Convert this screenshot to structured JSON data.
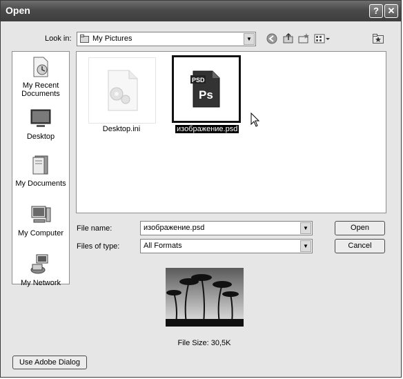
{
  "window": {
    "title": "Open",
    "help_label": "?",
    "close_label": "✕"
  },
  "lookin": {
    "label": "Look in:",
    "value": "My Pictures"
  },
  "places": [
    {
      "label": "My Recent Documents",
      "icon": "recent-documents-icon"
    },
    {
      "label": "Desktop",
      "icon": "desktop-icon"
    },
    {
      "label": "My Documents",
      "icon": "my-documents-icon"
    },
    {
      "label": "My Computer",
      "icon": "my-computer-icon"
    },
    {
      "label": "My Network",
      "icon": "my-network-icon"
    }
  ],
  "files": [
    {
      "name": "Desktop.ini",
      "icon": "ini-file-icon",
      "selected": false
    },
    {
      "name": "изображение.psd",
      "icon": "psd-file-icon",
      "selected": true,
      "badge": "PSD",
      "logo": "Ps"
    }
  ],
  "filename": {
    "label": "File name:",
    "value": "изображение.psd"
  },
  "filetype": {
    "label": "Files of type:",
    "value": "All Formats"
  },
  "buttons": {
    "open": "Open",
    "cancel": "Cancel",
    "adobe_dialog": "Use Adobe Dialog"
  },
  "preview": {
    "file_size": "File Size: 30,5K"
  }
}
